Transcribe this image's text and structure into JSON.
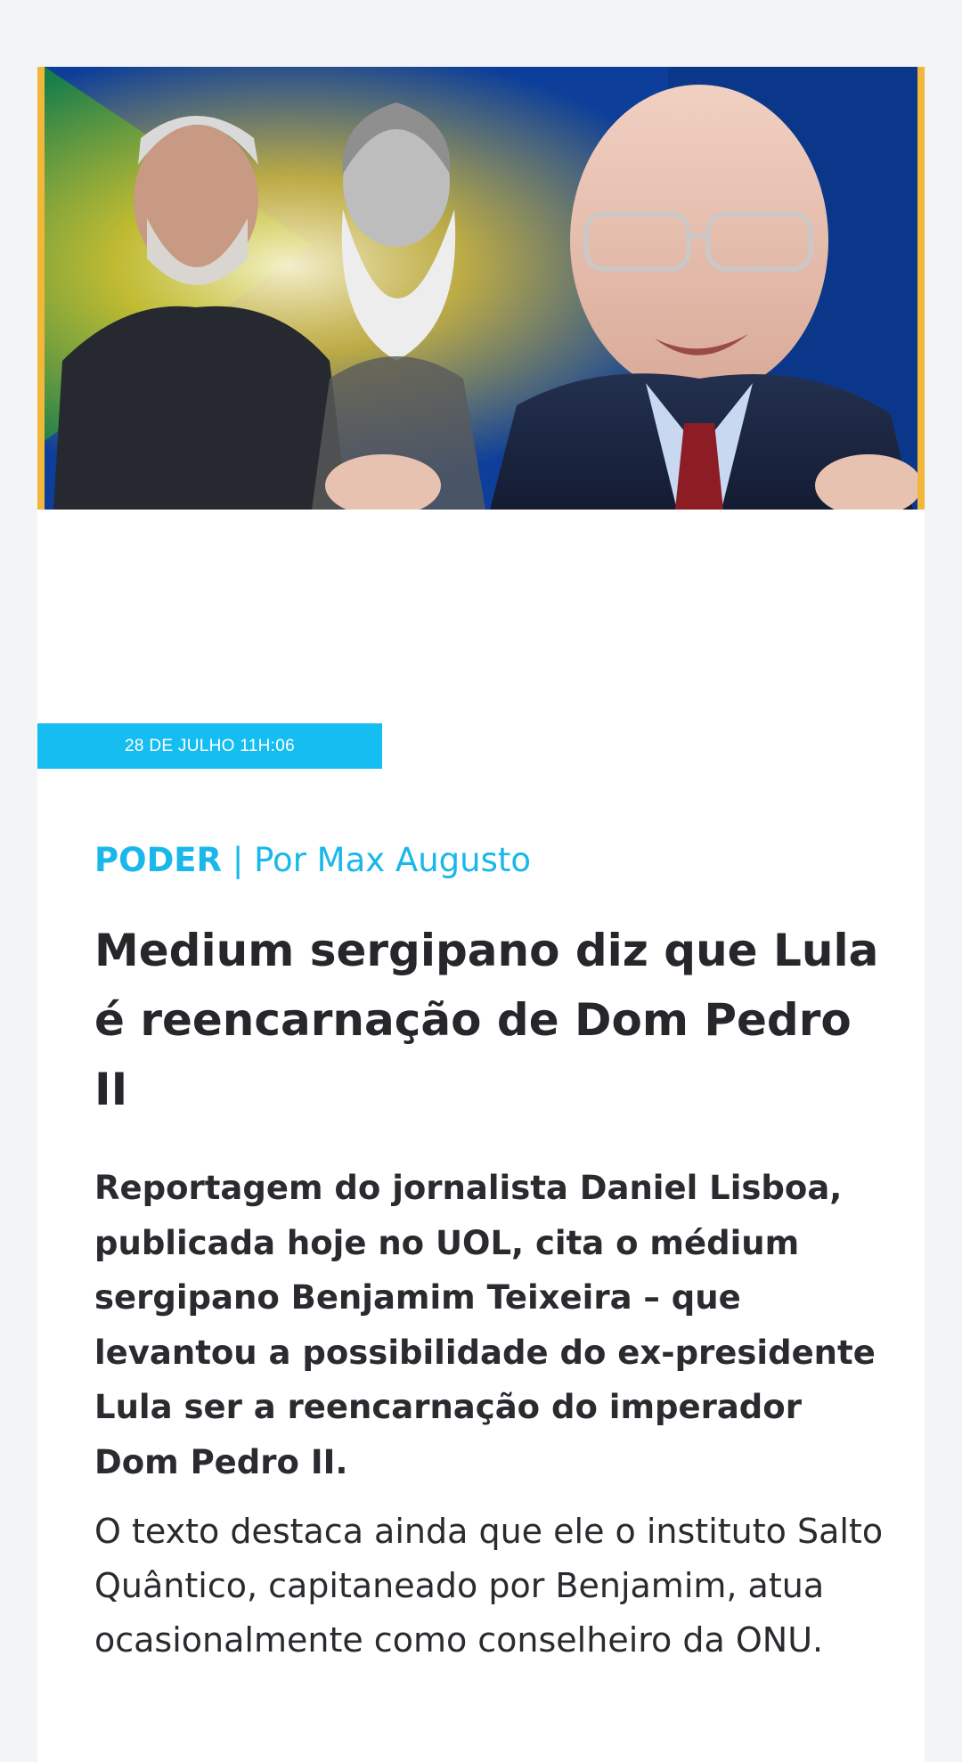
{
  "article": {
    "hero_image_alt": "Montagem com Lula, Dom Pedro II e Benjamim Teixeira",
    "date": "28 DE JULHO 11H:06",
    "section": "PODER",
    "separator": "|",
    "author_label": "Por Max Augusto",
    "title": "Medium sergipano diz que Lula é reencarnação de Dom Pedro II",
    "lead": "Reportagem do jornalista Daniel Lisboa, publicada hoje no UOL, cita o médium sergipano Benjamim Teixeira – que levantou a possibilidade do ex-presidente Lula ser a reencarnação do imperador Dom Pedro II.",
    "body": "O texto destaca ainda que ele o instituto Salto Quântico, capitaneado por Benjamim, atua ocasionalmente como conselheiro da ONU."
  },
  "colors": {
    "accent": "#16bdf1",
    "meta_text": "#19b7ea",
    "page_bg": "#f3f4f6",
    "hero_border": "#f0b73a",
    "headline_text": "#26262b"
  }
}
